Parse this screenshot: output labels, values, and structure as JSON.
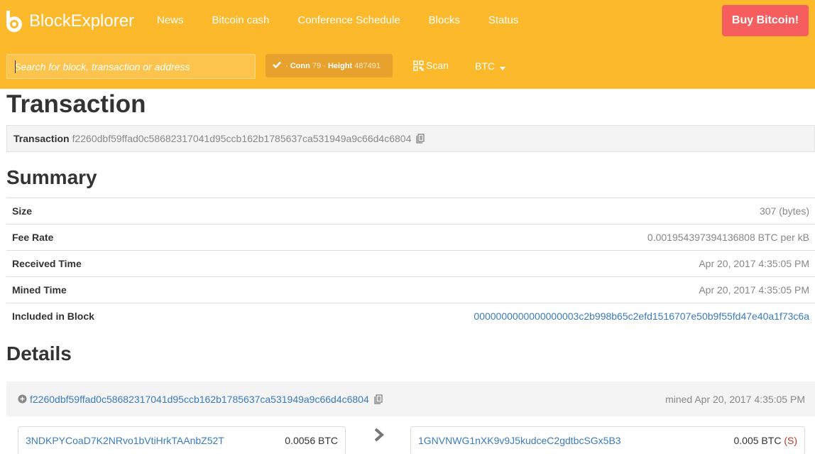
{
  "brand": {
    "name": "BlockExplorer"
  },
  "nav": {
    "items": [
      "News",
      "Bitcoin cash",
      "Conference Schedule",
      "Blocks",
      "Status"
    ]
  },
  "buy_button": "Buy Bitcoin!",
  "search": {
    "placeholder": "Search for block, transaction or address"
  },
  "status": {
    "conn_label": "Conn",
    "conn_value": "79",
    "height_label": "Height",
    "height_value": "487491",
    "separator": "·"
  },
  "scan_label": "Scan",
  "currency": "BTC",
  "page_title": "Transaction",
  "tx": {
    "label": "Transaction",
    "hash": "f2260dbf59ffad0c58682317041d95ccb162b1785637ca531949a9c66d4c6804"
  },
  "summary": {
    "title": "Summary",
    "rows": [
      {
        "label": "Size",
        "value": "307 (bytes)"
      },
      {
        "label": "Fee Rate",
        "value": "0.00195439739413680​8 BTC per kB"
      },
      {
        "label": "Received Time",
        "value": "Apr 20, 2017 4:35:05 PM"
      },
      {
        "label": "Mined Time",
        "value": "Apr 20, 2017 4:35:05 PM"
      },
      {
        "label": "Included in Block",
        "value": "0000000000000000003c2b998b65c2efd1516707e50b9f55fd47e40a1f73c6a"
      }
    ]
  },
  "details": {
    "title": "Details",
    "tx_hash": "f2260dbf59ffad0c58682317041d95ccb162b1785637ca531949a9c66d4c6804",
    "mined": "mined Apr 20, 2017 4:35:05 PM",
    "input": {
      "address": "3NDKPYCoaD7K2NRvo1bVtiHrkTAAnbZ52T",
      "amount": "0.0056 BTC"
    },
    "output": {
      "address": "1GNVNWG1nXK9v9J5kudceC2gdtbcSGx5B3",
      "amount": "0.005 BTC",
      "flag": "(S)"
    }
  },
  "colors": {
    "header": "#fbb92b",
    "buy": "#f65d5e",
    "link": "#3b7bbf"
  },
  "icons": [
    "logo-icon",
    "check-icon",
    "copy-icon",
    "qr-icon",
    "caret-down-icon",
    "plus-circle-icon",
    "chevron-right-icon"
  ]
}
